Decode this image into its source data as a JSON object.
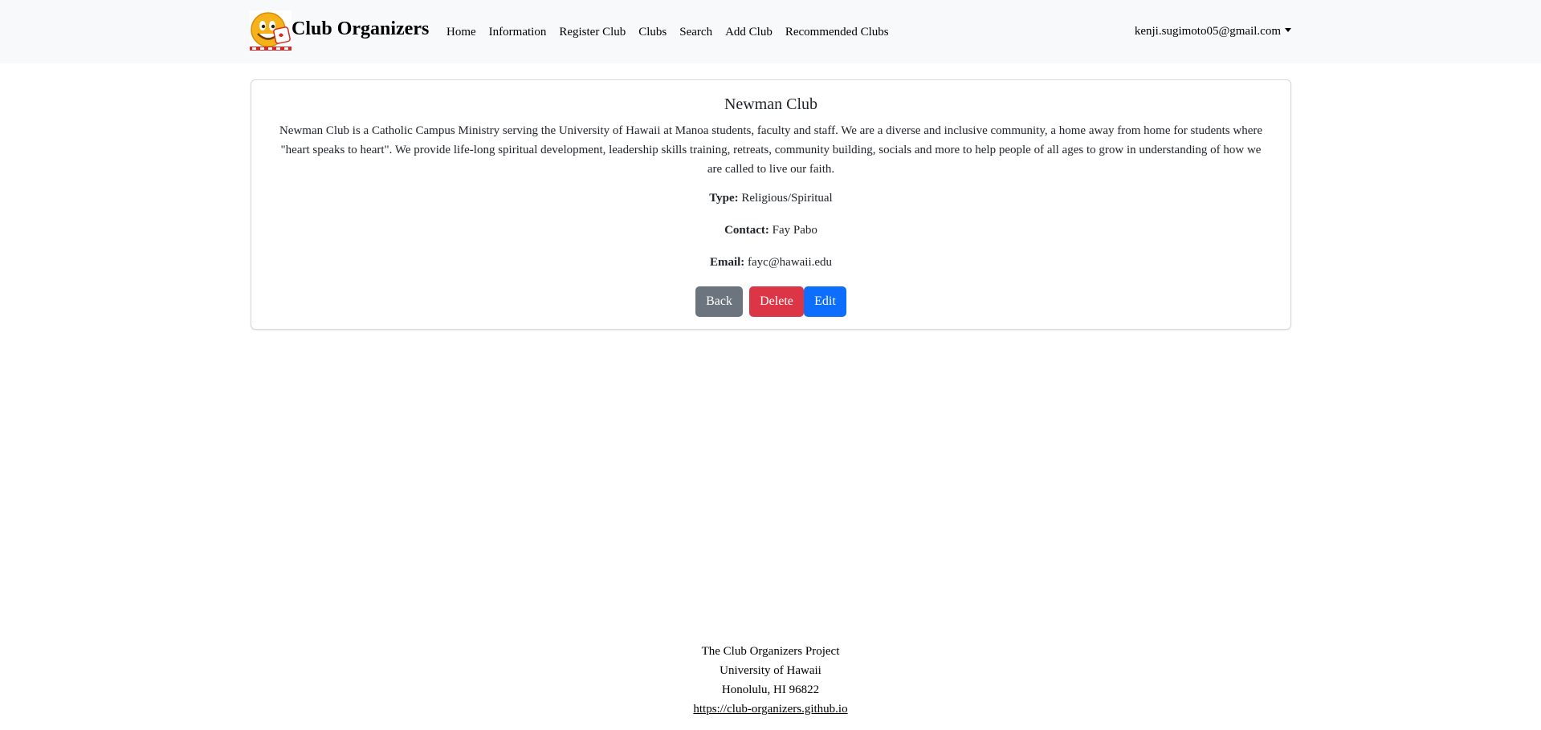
{
  "navbar": {
    "brand": "Club Organizers",
    "logo_icon": "smiley-logo-icon",
    "links": {
      "home": "Home",
      "information": "Information",
      "register_club": "Register Club",
      "clubs": "Clubs",
      "search": "Search",
      "add_club": "Add Club",
      "recommended_clubs": "Recommended Clubs"
    },
    "user_email": "kenji.sugimoto05@gmail.com",
    "background_color": "#f8f9fa"
  },
  "club": {
    "name": "Newman Club",
    "description": "Newman Club is a Catholic Campus Ministry serving the University of Hawaii at Manoa students, faculty and staff. We are a diverse and inclusive community, a home away from home for students where \"heart speaks to heart\". We provide life-long spiritual development, leadership skills training, retreats, community building, socials and more to help people of all ages to grow in understanding of how we are called to live our faith.",
    "type_label": "Type:",
    "type_value": "Religious/Spiritual",
    "contact_label": "Contact:",
    "contact_value": "Fay Pabo",
    "email_label": "Email:",
    "email_value": "fayc@hawaii.edu"
  },
  "buttons": {
    "back": "Back",
    "delete": "Delete",
    "edit": "Edit",
    "colors": {
      "back": "#6c757d",
      "delete": "#dc3545",
      "edit": "#0d6efd"
    }
  },
  "footer": {
    "line1": "The Club Organizers Project",
    "line2": "University of Hawaii",
    "line3": "Honolulu, HI 96822",
    "link": "https://club-organizers.github.io"
  }
}
